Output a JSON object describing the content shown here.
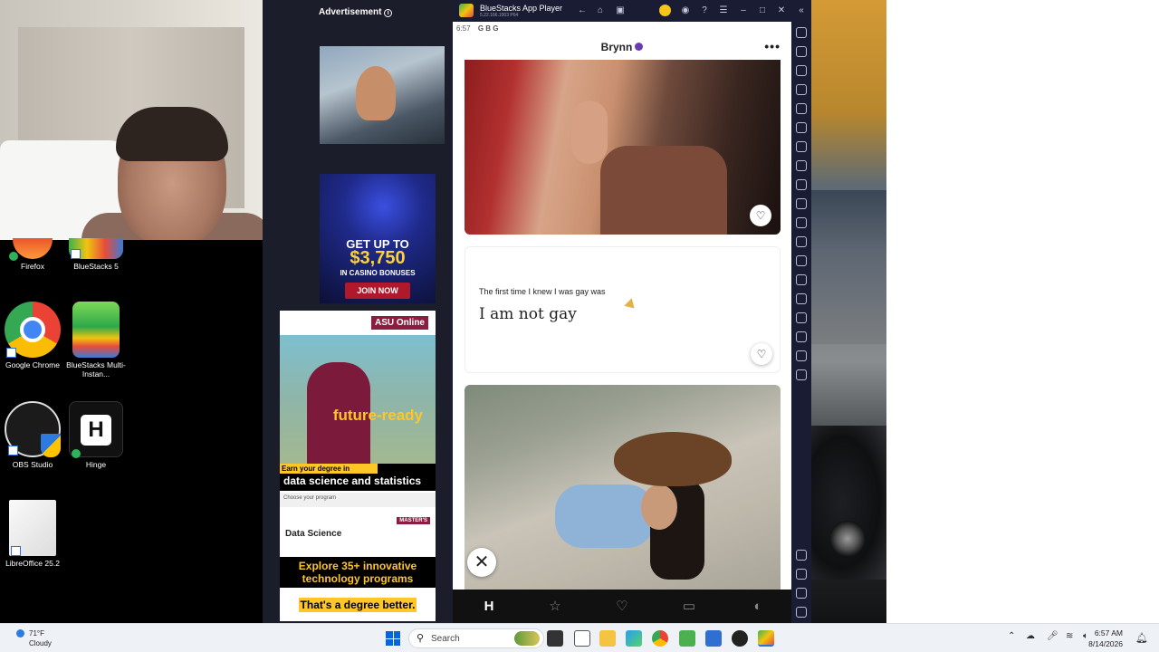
{
  "ad": {
    "header": "Advertisement",
    "info_icon": "info-icon",
    "casino": {
      "line1": "GET UP TO",
      "amount": "$3,750",
      "line2": "IN CASINO BONUSES",
      "cta": "JOIN NOW"
    },
    "asu": {
      "logo": "ASU Online",
      "tagline": "future-ready",
      "earn": "Earn your degree in",
      "program": "data science and statistics",
      "choose": "Choose your program",
      "degree_name": "Data Science",
      "degree_badge": "MASTER'S",
      "explore": "Explore 35+ innovative technology programs",
      "slogan": "That's a degree better."
    }
  },
  "bluestacks": {
    "title": "BlueStacks App Player",
    "subtitle": "5.22.166.1003 P64"
  },
  "phone": {
    "status_time": "6:57",
    "status_icons": "G B G",
    "profile_name": "Brynn",
    "prompt_question": "The first time I knew I was gay was",
    "prompt_answer": "I am not gay"
  },
  "desktop_icons": [
    {
      "label": "Firefox"
    },
    {
      "label": "BlueStacks 5"
    },
    {
      "label": "Google Chrome"
    },
    {
      "label": "BlueStacks Multi-Instan..."
    },
    {
      "label": "OBS Studio"
    },
    {
      "label": "Hinge"
    },
    {
      "label": "LibreOffice 25.2"
    }
  ],
  "taskbar": {
    "weather_temp": "71°F",
    "weather_cond": "Cloudy",
    "search_label": "Search",
    "time": "6:57 AM",
    "date": "8/14/2026"
  },
  "colors": {
    "bluestacks_bg": "#1a1c33",
    "hinge_verified": "#6a3bb5",
    "asu_maroon": "#8c1d40",
    "asu_gold": "#ffc627"
  }
}
